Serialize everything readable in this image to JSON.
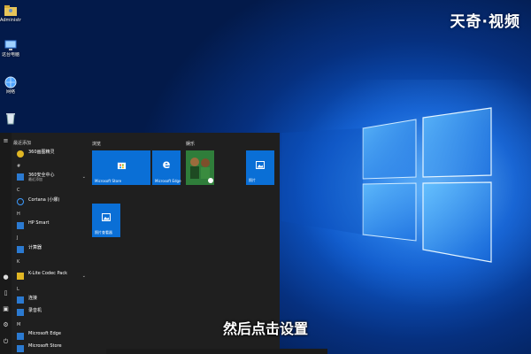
{
  "watermark": "天奇·视频",
  "subtitle": "然后点击设置",
  "desktop_icons": [
    {
      "label": "Administr...",
      "icon": "user-folder-icon"
    },
    {
      "label": "这台电脑",
      "icon": "computer-icon"
    },
    {
      "label": "网络",
      "icon": "network-icon"
    },
    {
      "label": "",
      "icon": "recycle-bin-icon"
    }
  ],
  "start_menu": {
    "recent_header": "最近添加",
    "apps": [
      {
        "name": "360画图精灵",
        "sub": "",
        "color": "#e0b624"
      },
      {
        "letter": "#"
      },
      {
        "name": "360安全中心",
        "sub": "最近添加",
        "color": "#2b7ad1",
        "expand": true
      },
      {
        "letter": "C"
      },
      {
        "name": "Cortana (小娜)",
        "sub": "",
        "color": "#2b7ad1"
      },
      {
        "letter": "H"
      },
      {
        "name": "HP Smart",
        "sub": "",
        "color": "#2b7ad1"
      },
      {
        "letter": "J"
      },
      {
        "name": "计算器",
        "sub": "",
        "color": "#2b7ad1"
      },
      {
        "letter": "K"
      },
      {
        "name": "K-Lite Codec Pack",
        "sub": "",
        "color": "#2b7ad1",
        "expand": true
      },
      {
        "letter": "L"
      },
      {
        "name": "连接",
        "sub": "",
        "color": "#2b7ad1"
      },
      {
        "name": "录音机",
        "sub": "",
        "color": "#2b7ad1"
      },
      {
        "letter": "M"
      },
      {
        "name": "Microsoft Edge",
        "sub": "",
        "color": "#2b7ad1"
      },
      {
        "name": "Microsoft Store",
        "sub": "",
        "color": "#2b7ad1"
      }
    ],
    "groups": {
      "browse": "浏览",
      "play": "娱乐"
    },
    "tiles": {
      "store": "Microsoft Store",
      "edge": "Microsoft Edge",
      "photos": "照片",
      "photo_viewer": "照片查看器"
    }
  },
  "colors": {
    "tile_blue": "#0a6fd6",
    "menu_bg": "#1f1f1f"
  }
}
